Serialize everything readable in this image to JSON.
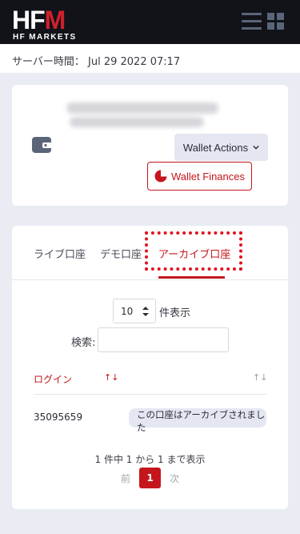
{
  "header": {
    "logo_main_prefix": "HF",
    "logo_main_accent": "M",
    "logo_sub": "HF MARKETS",
    "menu_icon": "hamburger-menu-icon",
    "apps_icon": "grid-apps-icon"
  },
  "server_time": {
    "label": "サーバー時間：",
    "value": "Jul 29 2022 07:17"
  },
  "wallet": {
    "icon": "wallet-icon",
    "actions_label": "Wallet Actions",
    "finances_label": "Wallet Finances"
  },
  "tabs": [
    {
      "label": "ライブ口座",
      "active": false
    },
    {
      "label": "デモ口座",
      "active": false
    },
    {
      "label": "アーカイブ口座",
      "active": true
    }
  ],
  "table_controls": {
    "page_length_value": "10",
    "page_length_suffix": "件表示",
    "search_label": "検索:",
    "search_value": ""
  },
  "table": {
    "columns": [
      "ログイン"
    ],
    "sort_active_symbol": "↑↓",
    "sort_idle_symbol": "↑↓",
    "rows": [
      {
        "login": "35095659",
        "status": "この口座はアーカイブされました"
      }
    ]
  },
  "pagination": {
    "info": "1 件中 1 から 1 まで表示",
    "prev": "前",
    "current": "1",
    "next": "次"
  },
  "colors": {
    "brand_red": "#c4161c",
    "header_bg": "#111318",
    "page_bg": "#e9ecf3",
    "highlight": "#e0141e"
  }
}
